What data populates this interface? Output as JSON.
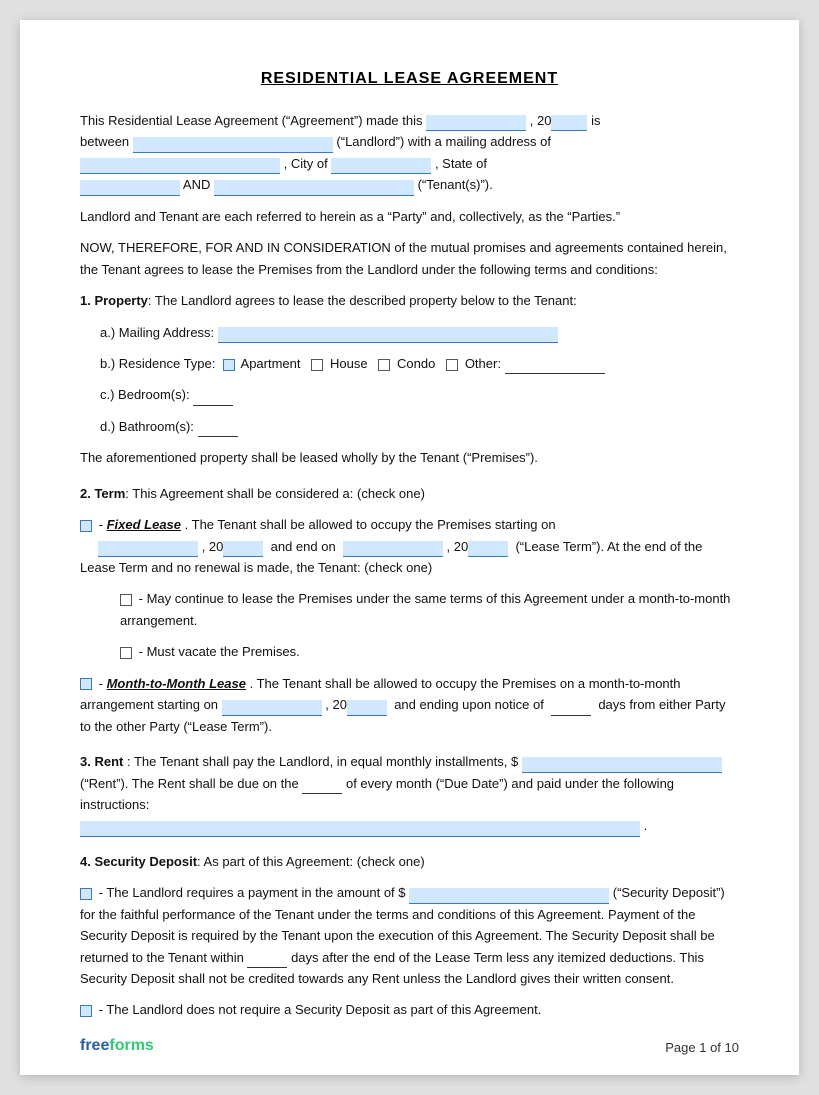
{
  "title": "RESIDENTIAL LEASE AGREEMENT",
  "intro": {
    "line1_pre": "This Residential Lease Agreement (“Agreement”) made this",
    "line1_mid": ", 20",
    "line1_post": "is",
    "line2_pre": "between",
    "line2_mid": "(“Landlord”) with a mailing address of",
    "line3_pre": "",
    "line3_city": ", City of",
    "line3_post": ", State of",
    "line4_pre": "",
    "line4_and": "AND",
    "line4_post": "(“Tenant(s)”)."
  },
  "parties_text": "Landlord and Tenant are each referred to herein as a “Party” and, collectively, as the “Parties.”",
  "consideration_text": "NOW, THEREFORE, FOR AND IN CONSIDERATION of the mutual promises and agreements contained herein, the Tenant agrees to lease the Premises from the Landlord under the following terms and conditions:",
  "section1": {
    "heading": "1. Property",
    "intro": ": The Landlord agrees to lease the described property below to the Tenant:",
    "a_label": "a.)  Mailing Address:",
    "b_label": "b.)  Residence Type:",
    "b_option1": "☐ Apartment",
    "b_option2": "House",
    "b_option3": "☐ Condo",
    "b_option4": "☐ Other:",
    "c_label": "c.)  Bedroom(s):",
    "d_label": "d.)  Bathroom(s):",
    "closing": "The aforementioned property shall be leased wholly by the Tenant (“Premises”)."
  },
  "section2": {
    "heading": "2. Term",
    "intro": ": This Agreement shall be considered a: (check one)",
    "fixed_pre": "- ",
    "fixed_label": "Fixed Lease",
    "fixed_text": ". The Tenant shall be allowed to occupy the Premises starting on",
    "fixed_date1_pre": "",
    "fixed_date1_mid": ", 20",
    "fixed_date1_post": "and end on",
    "fixed_date2_mid": ", 20",
    "fixed_date2_post": "(“Lease Term”). At the end of the Lease Term and no renewal is made, the Tenant: (check one)",
    "option1": "- May continue to lease the Premises under the same terms of this Agreement under a month-to-month arrangement.",
    "option2": "- Must vacate the Premises.",
    "month_pre": "- ",
    "month_label": "Month-to-Month Lease",
    "month_text": ". The Tenant shall be allowed to occupy the Premises on a month-to-month arrangement starting on",
    "month_date_mid": ", 20",
    "month_date_post": "and ending upon notice of",
    "month_days": "days from either Party to the other Party (“Lease Term”)."
  },
  "section3": {
    "heading": "3. Rent",
    "text1": ": The Tenant shall pay the Landlord, in equal monthly installments, $",
    "text2": "(“Rent”). The Rent shall be due on the",
    "text3": "of every month (“Due Date”) and paid under the following instructions:",
    "text4": "."
  },
  "section4": {
    "heading": "4. Security Deposit",
    "intro": ": As part of this Agreement: (check one)",
    "option1_pre": "- The Landlord requires a payment in the amount of $",
    "option1_post": "(“Security Deposit”) for the faithful performance of the Tenant under the terms and conditions of this Agreement. Payment of the Security Deposit is required by the Tenant upon the execution of this Agreement. The Security Deposit shall be returned to the Tenant within",
    "option1_days": "days after the end of the Lease Term less any itemized deductions. This Security Deposit shall not be credited towards any Rent unless the Landlord gives their written consent.",
    "option2": "- The Landlord does not require a Security Deposit as part of this Agreement."
  },
  "footer": {
    "brand_free": "free",
    "brand_forms": "forms",
    "page_label": "Page 1 of 10"
  }
}
